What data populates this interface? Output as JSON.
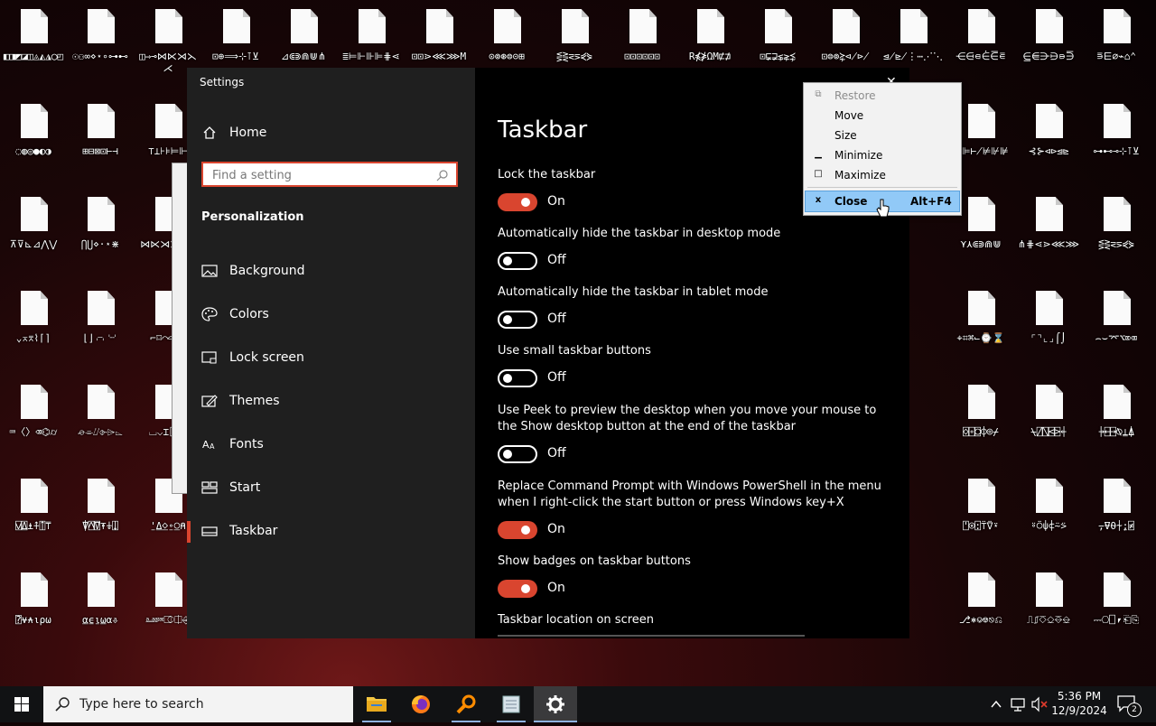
{
  "desktop": {
    "icons": [
      {
        "label": "◧◨◩◪◫◬◭◮◯◰"
      },
      {
        "label": "☉⚇∞⋄⋆∘⊶⊷"
      },
      {
        "label": "◫⇒⊸⋈⋉⋊⋋⋌"
      },
      {
        "label": "⊡⊕⟹⊹⊺⊻"
      },
      {
        "label": "⊿⋐⋑⋒⋓⋔"
      },
      {
        "label": "≣⊨⊩⊪⊫⋕⋖"
      },
      {
        "label": "⊡⊡⋗⋘⋙M"
      },
      {
        "label": "⊙⊚⊛⊜⊝⊞"
      },
      {
        "label": "⋚⋛⋜⋝⋞⋟"
      },
      {
        "label": "⊡⊡⊡⊡⊡⊡"
      },
      {
        "label": "R⋠⋡ΩM⋢⋣"
      },
      {
        "label": "⊡⋤⋥⋦⋧⋨"
      },
      {
        "label": "⊡⊜⊚⋩⋪⋫"
      },
      {
        "label": "⋬⋭⋮⋯⋰⋱"
      },
      {
        "label": "⋲⋳⋴⋵⋶⋷"
      },
      {
        "label": "⋸⋹⋺⋻⋼⋽"
      },
      {
        "label": "⋾⋿⌀⌁⌂⌃"
      },
      {
        "label": "◌◍◎●◐◑"
      },
      {
        "label": "⊞⊟⊠⊡⊢⊣"
      },
      {
        "label": "⊤⊥⊦⊧⊨⊩"
      },
      {
        "label": "⊪⊫⊬⊭⊮⊯"
      },
      {
        "label": "⊰⊱⊲⊳⊴⊵"
      },
      {
        "label": "⊶⊷⊸⊹⊺⊻"
      },
      {
        "label": "⊼⊽⊾⊿⋀⋁"
      },
      {
        "label": "⋂⋃⋄⋅⋆⋇"
      },
      {
        "label": "⋈⋉⋊⋋⋌⋍"
      },
      {
        "label": "⋎⋏⋐⋑⋒⋓"
      },
      {
        "label": "⋔⋕⋖⋗⋘⋙"
      },
      {
        "label": "⋚⋛⋜⋝⋞⋟"
      },
      {
        "label": "⌄⌅⌆⌇⌈⌉"
      },
      {
        "label": "⌊⌋⌌⌍⌎⌏"
      },
      {
        "label": "⌐⌑⌒⌓⌔⌕"
      },
      {
        "label": "⌖⌗⌘⌙⌚⌛"
      },
      {
        "label": "⌜⌝⌞⌟⌠⌡"
      },
      {
        "label": "⌢⌣⌤⌥⌦⌧"
      },
      {
        "label": "⌨〈〉⌫⌬⌭"
      },
      {
        "label": "⌮⌯⌰⌱⌲⌳"
      },
      {
        "label": "⌴⌵⌶⌷⌸⌹"
      },
      {
        "label": "⌺⌻⌼⌽⌾⌿"
      },
      {
        "label": "⍀⍁⍂⍃⍄⍅"
      },
      {
        "label": "⍆⍇⍈⍉⍊⍋"
      },
      {
        "label": "⍌⍍⍎⍏⍐⍑"
      },
      {
        "label": "⍒⍓⍔⍕⍖⍗"
      },
      {
        "label": "⍘⍙⍚⍛⍜⍝"
      },
      {
        "label": "⍞⍟⍠⍡⍢⍣"
      },
      {
        "label": "⍤⍥⍦⍧⍨⍩"
      },
      {
        "label": "⍪⍫⍬⍭⍮⍯"
      },
      {
        "label": "⍰⍱⍲⍳⍴⍵"
      },
      {
        "label": "⍶⍷⍸⍹⍺⎀"
      },
      {
        "label": "⎁⎂⎃⎄⎅⎆"
      },
      {
        "label": "⎇⎈⎉⎊⎋⎌"
      },
      {
        "label": "⎍⎎⎏⎐⎑⎒"
      },
      {
        "label": "⎓⎔⎕⎖⎗⎘"
      }
    ]
  },
  "window": {
    "title": "Settings",
    "close_glyph": "✕"
  },
  "sidebar": {
    "home_label": "Home",
    "search_placeholder": "Find a setting",
    "section_title": "Personalization",
    "items": [
      {
        "label": "Background"
      },
      {
        "label": "Colors"
      },
      {
        "label": "Lock screen"
      },
      {
        "label": "Themes"
      },
      {
        "label": "Fonts"
      },
      {
        "label": "Start"
      },
      {
        "label": "Taskbar"
      }
    ]
  },
  "content": {
    "title": "Taskbar",
    "settings": [
      {
        "label": "Lock the taskbar",
        "state": "On"
      },
      {
        "label": "Automatically hide the taskbar in desktop mode",
        "state": "Off"
      },
      {
        "label": "Automatically hide the taskbar in tablet mode",
        "state": "Off"
      },
      {
        "label": "Use small taskbar buttons",
        "state": "Off"
      },
      {
        "label": "Use Peek to preview the desktop when you move your mouse to the Show desktop button at the end of the taskbar",
        "state": "Off"
      },
      {
        "label": "Replace Command Prompt with Windows PowerShell in the menu when I right-click the start button or press Windows key+X",
        "state": "On"
      },
      {
        "label": "Show badges on taskbar buttons",
        "state": "On"
      }
    ],
    "location_label": "Taskbar location on screen"
  },
  "context_menu": {
    "items": [
      {
        "label": "Restore",
        "glyph": "⧉",
        "disabled": true
      },
      {
        "label": "Move",
        "glyph": "",
        "disabled": false
      },
      {
        "label": "Size",
        "glyph": "",
        "disabled": false
      },
      {
        "label": "Minimize",
        "glyph": "▁",
        "disabled": false
      },
      {
        "label": "Maximize",
        "glyph": "□",
        "disabled": false
      },
      {
        "label": "Close",
        "glyph": "x",
        "shortcut": "Alt+F4",
        "highlighted": true
      }
    ]
  },
  "taskbar": {
    "search_text": "Type here to search",
    "time": "5:36 PM",
    "date": "12/9/2024",
    "notification_count": "2"
  },
  "colors": {
    "accent": "#d9452f",
    "menu_highlight": "#91c9f7"
  }
}
